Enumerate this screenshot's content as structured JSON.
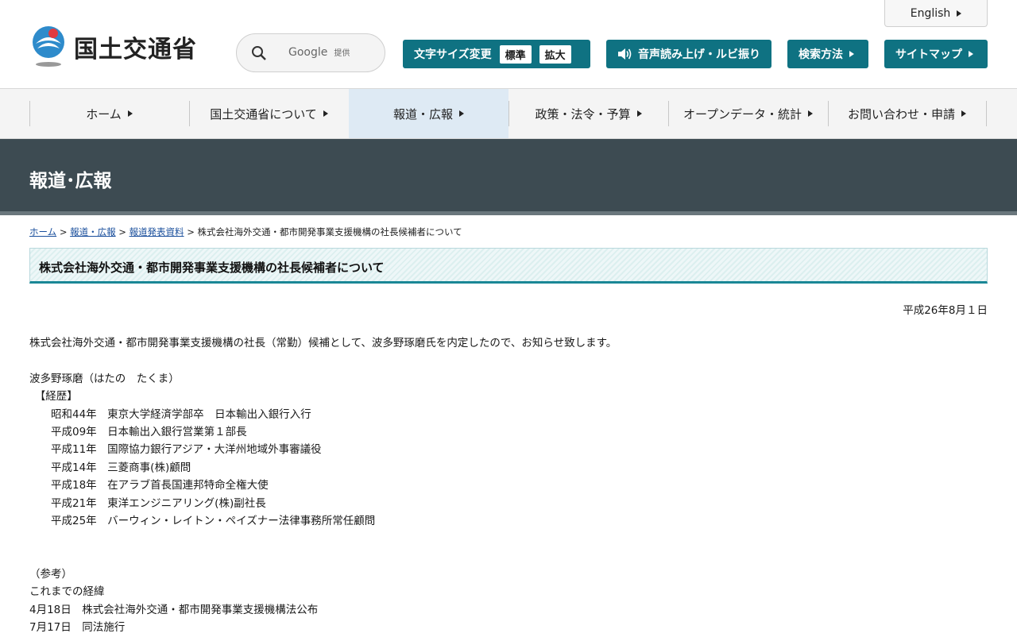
{
  "header": {
    "logo_text": "国土交通省",
    "search": {
      "provider": "Google",
      "suffix": "提供"
    },
    "font_size": {
      "label": "文字サイズ変更",
      "standard": "標準",
      "large": "拡大"
    },
    "voice_label": "音声読み上げ・ルビ振り",
    "search_method": "検索方法",
    "sitemap": "サイトマップ",
    "english": "English"
  },
  "nav": [
    {
      "label": "ホーム"
    },
    {
      "label": "国土交通省について"
    },
    {
      "label": "報道・広報"
    },
    {
      "label": "政策・法令・予算"
    },
    {
      "label": "オープンデータ・統計"
    },
    {
      "label": "お問い合わせ・申請"
    }
  ],
  "banner_title": "報道･広報",
  "breadcrumb": {
    "home": "ホーム",
    "press": "報道・広報",
    "releases": "報道発表資料",
    "current": "株式会社海外交通・都市開発事業支援機構の社長候補者について",
    "sep": ">"
  },
  "page_title": "株式会社海外交通・都市開発事業支援機構の社長候補者について",
  "date": "平成26年8月１日",
  "body_lines": [
    "株式会社海外交通・都市開発事業支援機構の社長（常勤）候補として、波多野琢磨氏を内定したので、お知らせ致します。",
    "",
    "波多野琢磨（はたの　たくま）",
    "　【経歴】",
    "　　昭和44年　東京大学経済学部卒　日本輸出入銀行入行",
    "　　平成09年　日本輸出入銀行営業第１部長",
    "　　平成11年　国際協力銀行アジア・大洋州地域外事審議役",
    "　　平成14年　三菱商事(株)顧問",
    "　　平成18年　在アラブ首長国連邦特命全権大使",
    "　　平成21年　東洋エンジニアリング(株)副社長",
    "　　平成25年　バーウィン・レイトン・ペイズナー法律事務所常任顧問",
    "",
    "",
    "（参考）",
    "これまでの経緯",
    "4月18日　株式会社海外交通・都市開発事業支援機構法公布",
    "7月17日　同法施行"
  ]
}
